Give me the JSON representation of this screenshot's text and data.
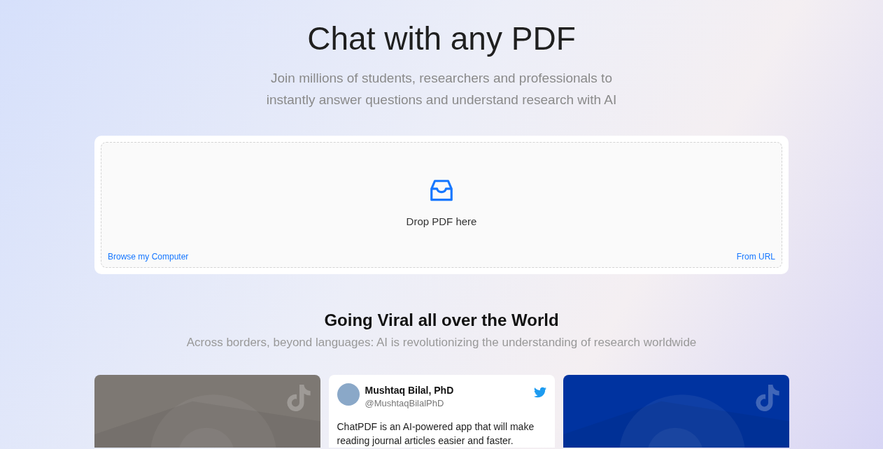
{
  "hero": {
    "title": "Chat with any PDF",
    "subtitle": "Join millions of students, researchers and professionals to instantly answer questions and understand research with AI"
  },
  "upload": {
    "prompt": "Drop PDF here",
    "browse_link": "Browse my Computer",
    "url_link": "From URL"
  },
  "viral": {
    "title": "Going Viral all over the World",
    "subtitle": "Across borders, beyond languages: AI is revolutionizing the understanding of research worldwide"
  },
  "cards": [
    {
      "kind": "video",
      "color": "#7d7873"
    },
    {
      "kind": "tweet",
      "name": "Mushtaq Bilal, PhD",
      "handle": "@MushtaqBilalPhD",
      "text": "ChatPDF is an AI-powered app that will make reading journal articles easier and faster."
    },
    {
      "kind": "video",
      "color": "#0033a0"
    }
  ]
}
